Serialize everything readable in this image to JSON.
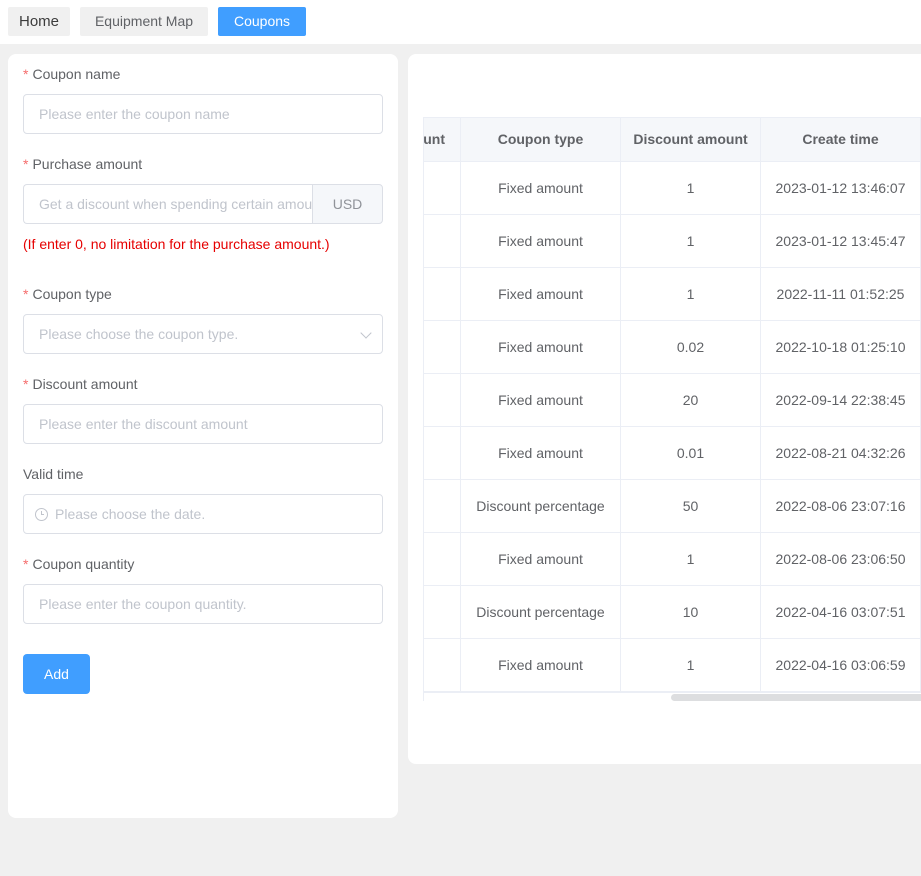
{
  "tabs": [
    {
      "label": "Home"
    },
    {
      "label": "Equipment Map"
    },
    {
      "label": "Coupons",
      "active": true
    }
  ],
  "form": {
    "coupon_name": {
      "label": "Coupon name",
      "required": "*",
      "placeholder": "Please enter the coupon name"
    },
    "purchase_amount": {
      "label": "Purchase amount",
      "required": "*",
      "placeholder": "Get a discount when spending certain amount",
      "append": "USD",
      "hint": "(If enter 0, no limitation for the purchase amount.)"
    },
    "coupon_type": {
      "label": "Coupon type",
      "required": "*",
      "placeholder": "Please choose the coupon type."
    },
    "discount_amount": {
      "label": "Discount amount",
      "required": "*",
      "placeholder": "Please enter the discount amount"
    },
    "valid_time": {
      "label": "Valid time",
      "placeholder": "Please choose the date."
    },
    "coupon_quantity": {
      "label": "Coupon quantity",
      "required": "*",
      "placeholder": "Please enter the coupon quantity."
    },
    "add_label": "Add"
  },
  "table": {
    "headers": [
      "unt",
      "Coupon type",
      "Discount amount",
      "Create time"
    ],
    "rows": [
      [
        "Fixed amount",
        "1",
        "2023-01-12 13:46:07"
      ],
      [
        "Fixed amount",
        "1",
        "2023-01-12 13:45:47"
      ],
      [
        "Fixed amount",
        "1",
        "2022-11-11 01:52:25"
      ],
      [
        "Fixed amount",
        "0.02",
        "2022-10-18 01:25:10"
      ],
      [
        "Fixed amount",
        "20",
        "2022-09-14 22:38:45"
      ],
      [
        "Fixed amount",
        "0.01",
        "2022-08-21 04:32:26"
      ],
      [
        "Discount percentage",
        "50",
        "2022-08-06 23:07:16"
      ],
      [
        "Fixed amount",
        "1",
        "2022-08-06 23:06:50"
      ],
      [
        "Discount percentage",
        "10",
        "2022-04-16 03:07:51"
      ],
      [
        "Fixed amount",
        "1",
        "2022-04-16 03:06:59"
      ]
    ]
  },
  "colors": {
    "accent": "#409eff",
    "required": "#f56c6c",
    "hint": "#e60000"
  }
}
